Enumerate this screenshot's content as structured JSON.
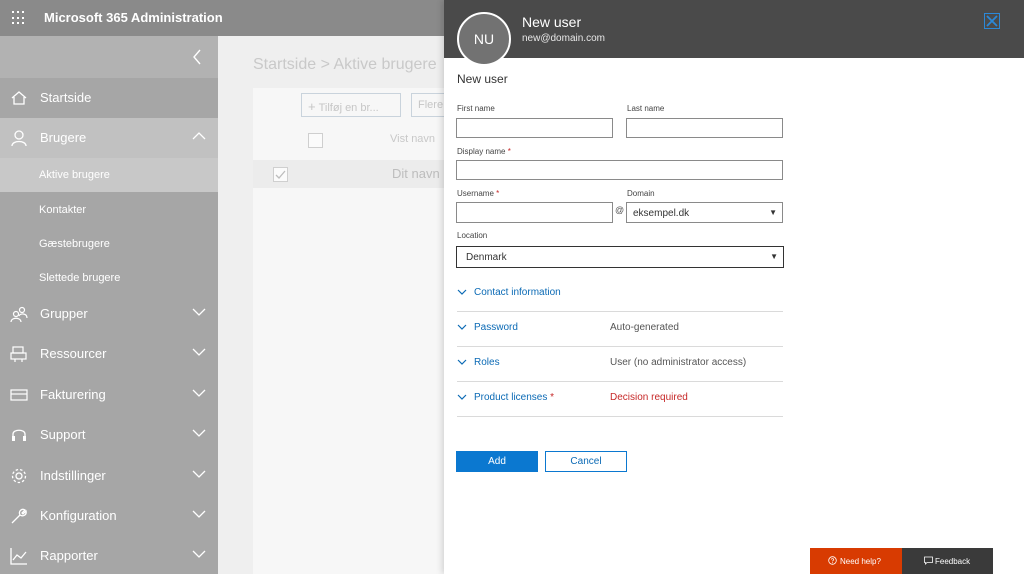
{
  "app": {
    "title": "Microsoft 365 Administration"
  },
  "sidebar": {
    "items": [
      {
        "label": "Startside",
        "icon": "home-icon"
      },
      {
        "label": "Brugere",
        "icon": "user-icon"
      },
      {
        "label": "Grupper",
        "icon": "groups-icon"
      },
      {
        "label": "Ressourcer",
        "icon": "resources-icon"
      },
      {
        "label": "Fakturering",
        "icon": "billing-icon"
      },
      {
        "label": "Support",
        "icon": "headset-icon"
      },
      {
        "label": "Indstillinger",
        "icon": "gear-icon"
      },
      {
        "label": "Konfiguration",
        "icon": "wrench-icon"
      },
      {
        "label": "Rapporter",
        "icon": "chart-icon"
      }
    ],
    "sub_items": [
      {
        "label": "Aktive brugere"
      },
      {
        "label": "Kontakter"
      },
      {
        "label": "Gæstebrugere"
      },
      {
        "label": "Slettede brugere"
      }
    ]
  },
  "main": {
    "breadcrumb": "Startside > Aktive brugere",
    "add_button": "Tilføj en br...",
    "more_button": "Flere",
    "column_header": "Vist navn",
    "row_name": "Dit navn"
  },
  "panel": {
    "avatar_initials": "NU",
    "title": "New user",
    "subtitle": "new@domain.com",
    "form_title": "New user",
    "fields": {
      "first_name_label": "First name",
      "last_name_label": "Last name",
      "display_name_label": "Display name",
      "username_label": "Username",
      "domain_label": "Domain",
      "location_label": "Location",
      "required_mark": "*",
      "at_sign": "@",
      "domain_value": "eksempel.dk",
      "location_value": "Denmark",
      "first_name_value": "",
      "last_name_value": "",
      "display_name_value": "",
      "username_value": ""
    },
    "sections": [
      {
        "title": "Contact information",
        "value": ""
      },
      {
        "title": "Password",
        "value": "Auto-generated"
      },
      {
        "title": "Roles",
        "value": "User (no administrator access)"
      },
      {
        "title": "Product licenses",
        "value": "Decision required",
        "required": "*"
      }
    ],
    "add_label": "Add",
    "cancel_label": "Cancel"
  },
  "help": {
    "need_help": "Need help?",
    "feedback": "Feedback"
  },
  "colors": {
    "accent": "#0b78d0",
    "warning": "#c62828",
    "help": "#d83b01"
  }
}
